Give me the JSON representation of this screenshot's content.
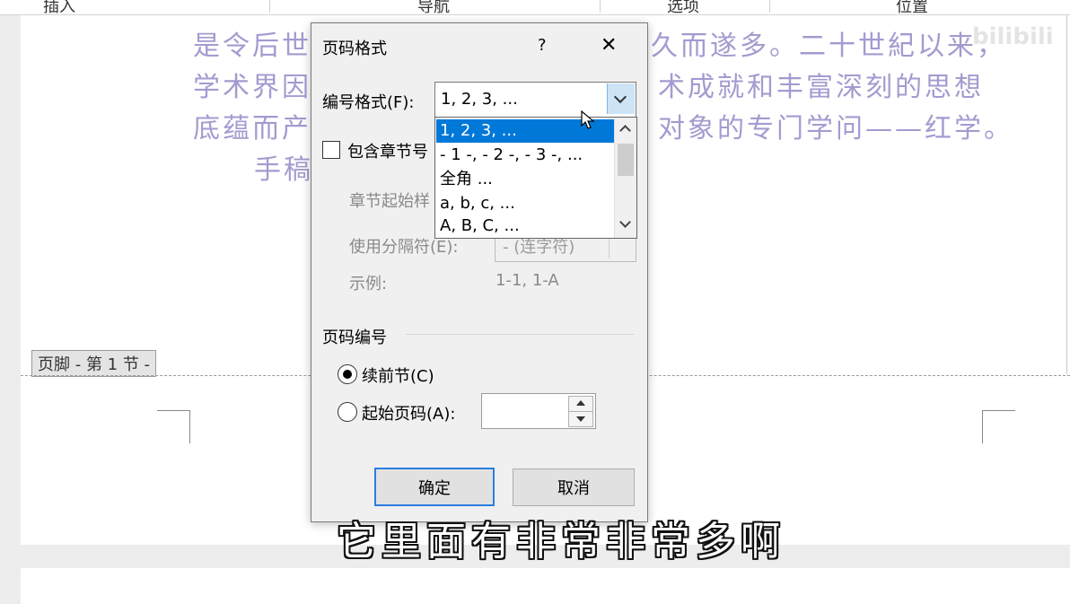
{
  "ribbon": {
    "tabs": [
      "插入",
      "导航",
      "选项",
      "位置"
    ]
  },
  "document": {
    "lines": [
      "是令后世",
      "久而遂多。二十世紀以来，",
      "学术界因",
      "术成就和丰富深刻的思想",
      "底蕴而产",
      "对象的专门学问——红学。",
      "手稿"
    ],
    "watermark": "bilibili",
    "footer_tag": "页脚 - 第 1 节 -"
  },
  "dialog": {
    "title": "页码格式",
    "help": "?",
    "close": "✕",
    "number_format_label": "编号格式(F):",
    "number_format_value": "1, 2, 3, ...",
    "include_chapter_label": "包含章节号",
    "chapter_start_label": "章节起始样",
    "separator_label": "使用分隔符(E):",
    "separator_value": "- (连字符)",
    "example_label": "示例:",
    "example_value": "1-1, 1-A",
    "page_numbering_label": "页码编号",
    "continue_label": "续前节(C)",
    "start_at_label": "起始页码(A):",
    "start_at_value": "",
    "ok": "确定",
    "cancel": "取消"
  },
  "dropdown": {
    "options": [
      "1, 2, 3, ...",
      "- 1 -, - 2 -, - 3 -, ...",
      "全角 ...",
      "a, b, c, ...",
      "A, B, C, ..."
    ],
    "selected_index": 0
  },
  "subtitle": "它里面有非常非常多啊",
  "colors": {
    "accent": "#0078d7",
    "body_text": "#a59ad0"
  }
}
